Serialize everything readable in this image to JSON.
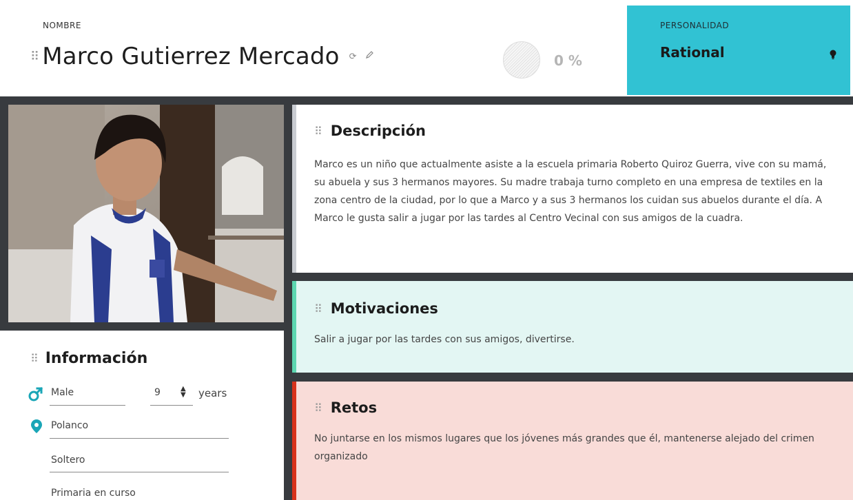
{
  "header": {
    "nombre_label": "NOMBRE",
    "name": "Marco Gutierrez Mercado",
    "progress_text": "0 %"
  },
  "personality": {
    "label": "PERSONALIDAD",
    "value": "Rational",
    "bg_color": "#31c2d3"
  },
  "info": {
    "title": "Información",
    "gender": "Male",
    "age": "9",
    "age_unit": "years",
    "location": "Polanco",
    "civil_status": "Soltero",
    "education": "Primaria en curso"
  },
  "descripcion": {
    "title": "Descripción",
    "text": "Marco es un niño que actualmente asiste a la escuela primaria Roberto Quiroz Guerra, vive con su mamá, su abuela y sus 3 hermanos mayores. Su madre trabaja turno completo en una empresa de textiles en la zona centro de la ciudad, por lo que a Marco y a sus 3 hermanos los cuidan sus abuelos durante el día. A Marco le gusta salir a jugar por las tardes al Centro Vecinal con sus amigos de la cuadra."
  },
  "motivaciones": {
    "title": "Motivaciones",
    "text": "Salir a jugar por las tardes con sus amigos, divertirse.",
    "accent": "#5dd6b0",
    "bg_color": "#e3f6f3"
  },
  "retos": {
    "title": "Retos",
    "text": "No juntarse en los mismos lugares que los jóvenes más grandes que él, mantenerse alejado del crimen organizado",
    "accent": "#d8321b",
    "bg_color": "#f9dcd8"
  },
  "colors": {
    "frame": "#383b3f",
    "gender_icon": "#1aa6b7"
  }
}
